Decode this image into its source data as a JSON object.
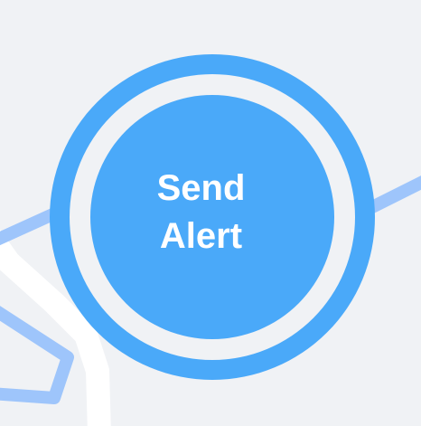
{
  "alert_button": {
    "line1": "Send",
    "line2": "Alert"
  },
  "colors": {
    "background": "#f0f2f5",
    "accent": "#4aa9f9",
    "route": "#9ec5fb",
    "road": "#ffffff",
    "label": "#ffffff"
  },
  "map": {
    "route_icon": "route-line",
    "road_icon": "road-line"
  }
}
